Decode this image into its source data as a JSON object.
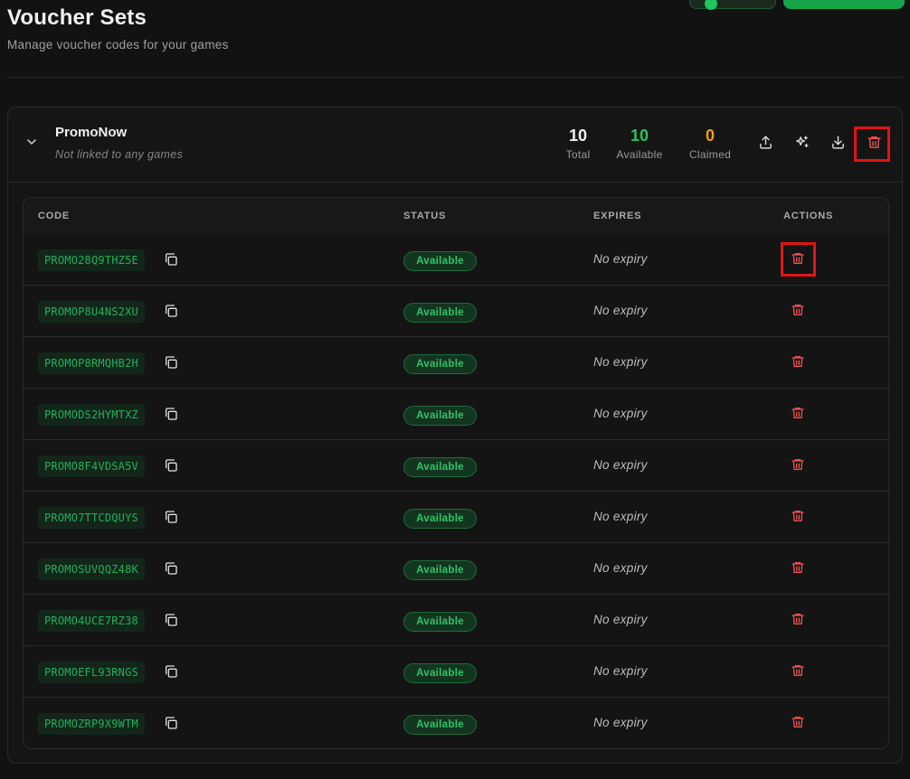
{
  "page": {
    "title": "Voucher Sets",
    "subtitle": "Manage voucher codes for your games"
  },
  "colors": {
    "accent": "#22c55e",
    "danger": "#f05252",
    "claimed": "#f59e0b",
    "highlight": "#e11414"
  },
  "voucher_set": {
    "name": "PromoNow",
    "linked_games": "Not linked to any games",
    "stats": {
      "total": {
        "value": "10",
        "label": "Total"
      },
      "available": {
        "value": "10",
        "label": "Available"
      },
      "claimed": {
        "value": "0",
        "label": "Claimed"
      }
    },
    "actions": [
      "upload-icon",
      "sparkles-icon",
      "download-icon",
      "trash-icon"
    ]
  },
  "table": {
    "columns": {
      "code": "CODE",
      "status": "STATUS",
      "expires": "EXPIRES",
      "actions": "ACTIONS"
    },
    "rows": [
      {
        "code": "PROMO28Q9THZ5E",
        "status": "Available",
        "expires": "No expiry"
      },
      {
        "code": "PROMOP8U4NS2XU",
        "status": "Available",
        "expires": "No expiry"
      },
      {
        "code": "PROMOP8RMQHB2H",
        "status": "Available",
        "expires": "No expiry"
      },
      {
        "code": "PROMODS2HYMTXZ",
        "status": "Available",
        "expires": "No expiry"
      },
      {
        "code": "PROMO8F4VDSA5V",
        "status": "Available",
        "expires": "No expiry"
      },
      {
        "code": "PROMO7TTCDQUYS",
        "status": "Available",
        "expires": "No expiry"
      },
      {
        "code": "PROMOSUVQQZ48K",
        "status": "Available",
        "expires": "No expiry"
      },
      {
        "code": "PROMO4UCE7RZ38",
        "status": "Available",
        "expires": "No expiry"
      },
      {
        "code": "PROMOEFL93RNGS",
        "status": "Available",
        "expires": "No expiry"
      },
      {
        "code": "PROMOZRP9X9WTM",
        "status": "Available",
        "expires": "No expiry"
      }
    ]
  }
}
